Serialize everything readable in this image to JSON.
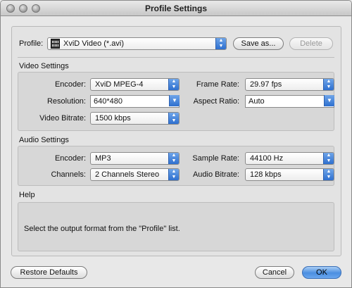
{
  "window": {
    "title": "Profile Settings"
  },
  "profile": {
    "label": "Profile:",
    "value": "XviD Video (*.avi)",
    "save_as": "Save as...",
    "delete": "Delete"
  },
  "video": {
    "title": "Video Settings",
    "encoder_label": "Encoder:",
    "encoder_value": "XviD MPEG-4",
    "resolution_label": "Resolution:",
    "resolution_value": "640*480",
    "bitrate_label": "Video Bitrate:",
    "bitrate_value": "1500 kbps",
    "framerate_label": "Frame Rate:",
    "framerate_value": "29.97 fps",
    "aspect_label": "Aspect Ratio:",
    "aspect_value": "Auto"
  },
  "audio": {
    "title": "Audio Settings",
    "encoder_label": "Encoder:",
    "encoder_value": "MP3",
    "channels_label": "Channels:",
    "channels_value": "2 Channels Stereo",
    "samplerate_label": "Sample Rate:",
    "samplerate_value": "44100 Hz",
    "bitrate_label": "Audio Bitrate:",
    "bitrate_value": "128 kbps"
  },
  "help": {
    "title": "Help",
    "text": "Select the output format from the \"Profile\" list."
  },
  "buttons": {
    "restore": "Restore Defaults",
    "cancel": "Cancel",
    "ok": "OK"
  }
}
